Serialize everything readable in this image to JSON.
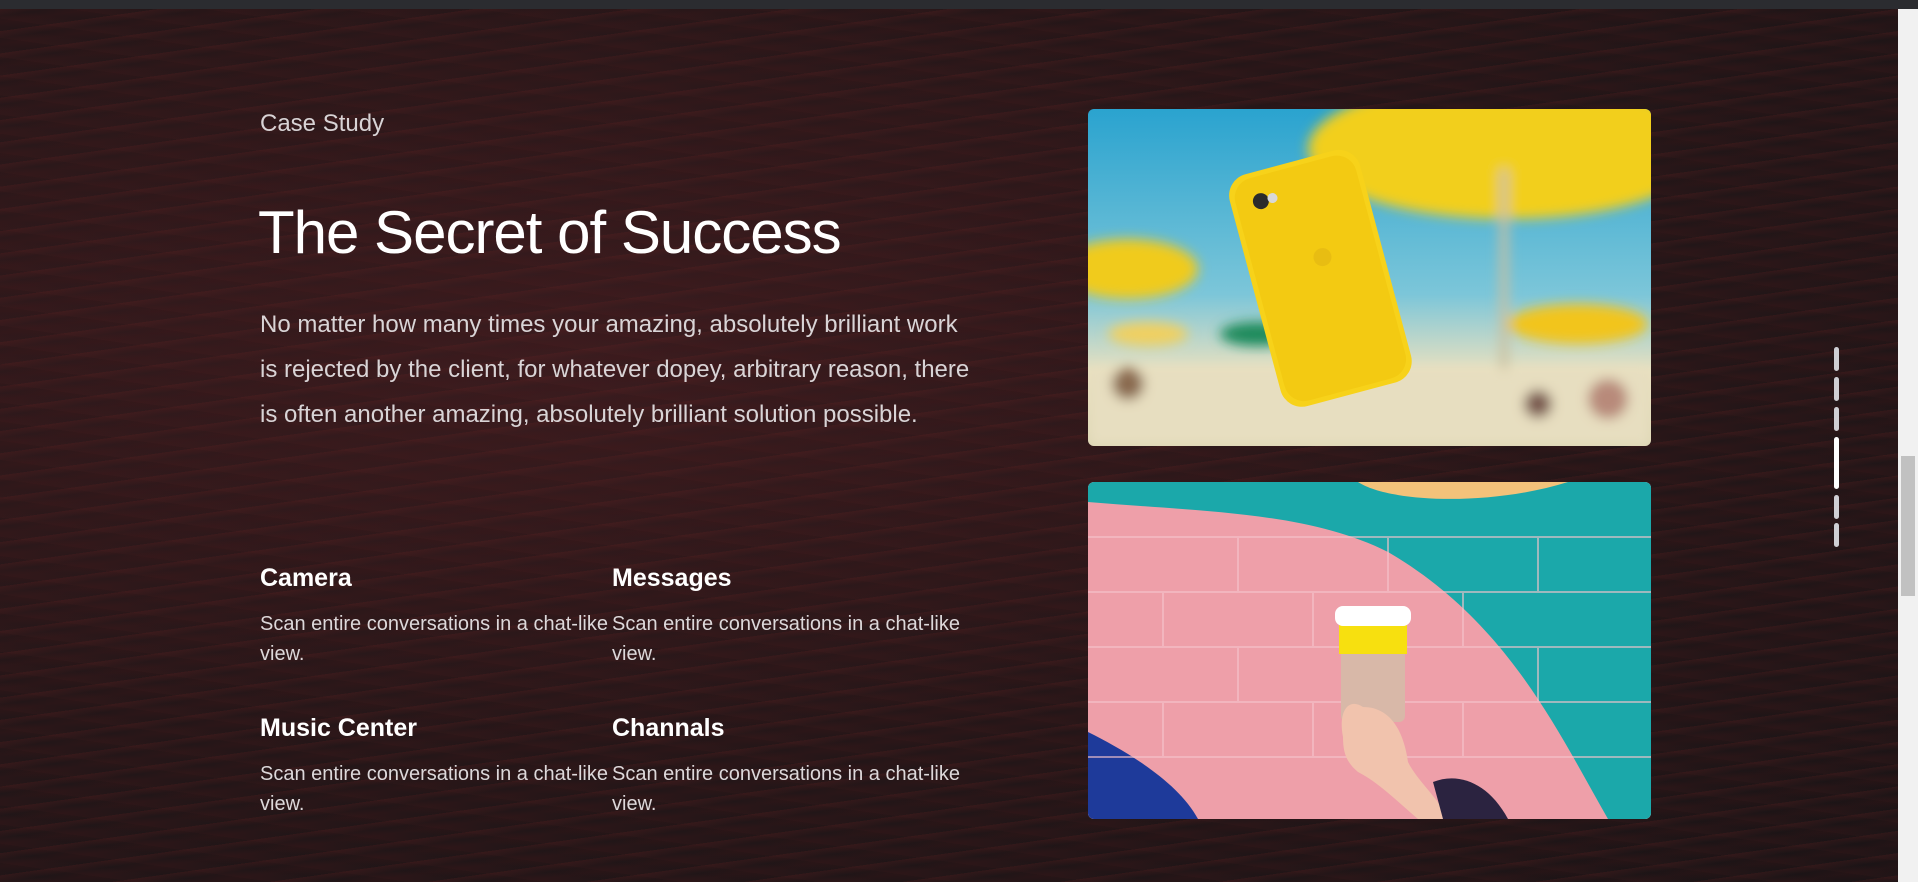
{
  "case_label": "Case Study",
  "title": "The Secret of Success",
  "intro": "No matter how many times your amazing, absolutely brilliant work is rejected by the client, for whatever dopey, arbitrary reason, there is often another amazing, absolutely brilliant solution possible.",
  "features": [
    {
      "title": "Camera",
      "text": "Scan entire conversations in a chat-like view."
    },
    {
      "title": "Messages",
      "text": "Scan entire conversations in a chat-like view."
    },
    {
      "title": "Music Center",
      "text": "Scan entire conversations in a chat-like view."
    },
    {
      "title": "Channals",
      "text": "Scan entire conversations in a chat-like view."
    }
  ],
  "images": [
    {
      "name": "yellow-phone-beach-image"
    },
    {
      "name": "coffee-cup-painted-wall-image"
    }
  ],
  "pagination": {
    "count": 6,
    "active_index": 3
  },
  "colors": {
    "accent_yellow": "#f7d21a",
    "teal": "#1aa7a8",
    "pink": "#eea7b0"
  }
}
